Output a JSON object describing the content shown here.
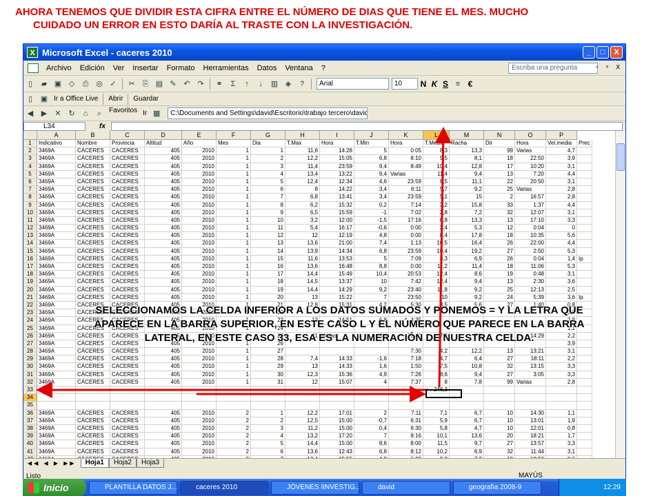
{
  "heading": {
    "line1": "AHORA TENEMOS QUE DIVIDIR ESTA CIFRA ENTRE EL NÚMERO DE DIAS QUE TIENE EL MES. MUCHO",
    "line2": "CUIDADO UN ERROR EN ESTO DARÍA AL TRASTE CON LA INVESTIGACIÓN."
  },
  "window": {
    "title": "Microsoft Excel - caceres 2010",
    "controls": [
      "_",
      "□",
      "X"
    ]
  },
  "menu": {
    "items": [
      "Archivo",
      "Edición",
      "Ver",
      "Insertar",
      "Formato",
      "Herramientas",
      "Datos",
      "Ventana",
      "?"
    ],
    "ask_placeholder": "Escriba una pregunta"
  },
  "toolbar": {
    "font": "Arial",
    "size": "10",
    "bold": "N",
    "italic": "K",
    "underline": "S",
    "currency": "€",
    "live": "Ir a Office Live",
    "open": "Abrir",
    "save": "Guardar",
    "favorites": "Favoritos",
    "go": "Ir",
    "address": "C:\\Documents and Settings\\david\\Escritorio\\trabajo tercero\\david\\"
  },
  "formula": {
    "namebox": "L34",
    "fx": "fx",
    "value": ""
  },
  "grid": {
    "columns": [
      "A",
      "B",
      "C",
      "D",
      "E",
      "F",
      "G",
      "H",
      "I",
      "J",
      "K",
      "L",
      "M",
      "N",
      "O",
      "P"
    ],
    "selected_column": "L",
    "selected_row": "34",
    "rows": [
      [
        "1",
        "Indicativo",
        "Nombre",
        "Provincia",
        "Altitud",
        "Año",
        "Mes",
        "Dia",
        "T.Max",
        "Hora",
        "T.Min",
        "Hora",
        "T.Media",
        "Racha",
        "Dir",
        "Hora",
        "Vel.media",
        "Prec"
      ],
      [
        "2",
        "3469A",
        "CÁCERES",
        "CACERES",
        "405",
        "2010",
        "1",
        "1",
        "11,6",
        "14:28",
        "5",
        "0:05",
        "8,3",
        "13,3",
        "99",
        "Varias",
        "4,7",
        ""
      ],
      [
        "3",
        "3469A",
        "CÁCERES",
        "CACERES",
        "405",
        "2010",
        "1",
        "2",
        "12,2",
        "15:05",
        "6,8",
        "8:10",
        "9,5",
        "8,1",
        "18",
        "22:50",
        "3,9",
        ""
      ],
      [
        "4",
        "3469A",
        "CÁCERES",
        "CACERES",
        "405",
        "2010",
        "1",
        "3",
        "11,4",
        "23:59",
        "9,4",
        "8:49",
        "10,4",
        "12,8",
        "17",
        "10:20",
        "3,1",
        ""
      ],
      [
        "5",
        "3469A",
        "CÁCERES",
        "CACERES",
        "405",
        "2010",
        "1",
        "4",
        "13,4",
        "13:22",
        "9,4",
        "Varias",
        "11,4",
        "9,4",
        "13",
        "7:20",
        "4,4",
        ""
      ],
      [
        "6",
        "3469A",
        "CÁCERES",
        "CACERES",
        "405",
        "2010",
        "1",
        "5",
        "12,4",
        "12:34",
        "4,6",
        "23:59",
        "8,5",
        "11,1",
        "22",
        "20:50",
        "3,1",
        ""
      ],
      [
        "7",
        "3469A",
        "CÁCERES",
        "CACERES",
        "405",
        "2010",
        "1",
        "6",
        "8",
        "14:22",
        "3,4",
        "6:11",
        "5,7",
        "9,2",
        "25",
        "Varias",
        "2,8",
        ""
      ],
      [
        "8",
        "3469A",
        "CÁCERES",
        "CACERES",
        "405",
        "2010",
        "1",
        "7",
        "6,8",
        "13:41",
        "3,4",
        "23:59",
        "5,1",
        "15",
        "2",
        "16:57",
        "2,8",
        ""
      ],
      [
        "9",
        "3469A",
        "CÁCERES",
        "CACERES",
        "405",
        "2010",
        "1",
        "8",
        "6,2",
        "15:32",
        "0,2",
        "7:14",
        "3,2",
        "15,8",
        "33",
        "1:37",
        "4,4",
        ""
      ],
      [
        "10",
        "3469A",
        "CÁCERES",
        "CACERES",
        "405",
        "2010",
        "1",
        "9",
        "6,5",
        "15:59",
        "-1",
        "7:02",
        "2,8",
        "7,2",
        "32",
        "12:07",
        "3,1",
        ""
      ],
      [
        "11",
        "3469A",
        "CÁCERES",
        "CACERES",
        "405",
        "2010",
        "1",
        "10",
        "3,2",
        "12:00",
        "-1,5",
        "17:16",
        "0,8",
        "13,3",
        "13",
        "17:10",
        "3,3",
        ""
      ],
      [
        "12",
        "3469A",
        "CÁCERES",
        "CACERES",
        "405",
        "2010",
        "1",
        "11",
        "5,4",
        "16:17",
        "-0,6",
        "0:00",
        "2,4",
        "5,3",
        "12",
        "0:04",
        "0",
        ""
      ],
      [
        "13",
        "3469A",
        "CÁCERES",
        "CACERES",
        "405",
        "2010",
        "1",
        "12",
        "12",
        "12:19",
        "4,8",
        "0:00",
        "8,4",
        "17,8",
        "18",
        "10:35",
        "5,6",
        ""
      ],
      [
        "14",
        "3469A",
        "CÁCERES",
        "CACERES",
        "405",
        "2010",
        "1",
        "13",
        "13,6",
        "21:00",
        "7,4",
        "1:13",
        "10,5",
        "16,4",
        "26",
        "22:00",
        "4,4",
        ""
      ],
      [
        "15",
        "3469A",
        "CÁCERES",
        "CACERES",
        "405",
        "2010",
        "1",
        "14",
        "13,9",
        "14:34",
        "6,8",
        "23:59",
        "10,4",
        "19,2",
        "27",
        "2:50",
        "5,3",
        ""
      ],
      [
        "16",
        "3469A",
        "CÁCERES",
        "CACERES",
        "405",
        "2010",
        "1",
        "15",
        "11,6",
        "13:53",
        "5",
        "7:09",
        "8,3",
        "6,9",
        "26",
        "0:04",
        "1,4",
        "Ip"
      ],
      [
        "17",
        "3469A",
        "CÁCERES",
        "CACERES",
        "405",
        "2010",
        "1",
        "16",
        "13,6",
        "16:48",
        "8,8",
        "0:00",
        "11,2",
        "11,4",
        "18",
        "11:06",
        "5,3",
        ""
      ],
      [
        "18",
        "3469A",
        "CÁCERES",
        "CACERES",
        "405",
        "2010",
        "1",
        "17",
        "14,4",
        "15:49",
        "10,4",
        "20:53",
        "12,4",
        "8,6",
        "19",
        "0:48",
        "3,1",
        ""
      ],
      [
        "19",
        "3469A",
        "CÁCERES",
        "CACERES",
        "405",
        "2010",
        "1",
        "18",
        "14,5",
        "13:37",
        "10",
        "7:42",
        "12,4",
        "9,4",
        "13",
        "2:30",
        "3,6",
        ""
      ],
      [
        "20",
        "3469A",
        "CÁCERES",
        "CACERES",
        "405",
        "2010",
        "1",
        "19",
        "14,4",
        "14:29",
        "9,2",
        "23:40",
        "11,8",
        "9,2",
        "25",
        "12:13",
        "2,5",
        ""
      ],
      [
        "21",
        "3469A",
        "CÁCERES",
        "CACERES",
        "405",
        "2010",
        "1",
        "20",
        "13",
        "15:22",
        "7",
        "23:50",
        "10",
        "9,2",
        "24",
        "5:39",
        "3,6",
        "Ip"
      ],
      [
        "22",
        "3469A",
        "CÁCERES",
        "CACERES",
        "405",
        "2010",
        "1",
        "21",
        "12,8",
        "15:31",
        "4,2",
        "5:30",
        "8,5",
        "5,6",
        "27",
        "1:40",
        "0,8",
        ""
      ],
      [
        "23",
        "3469A",
        "CÁCERES",
        "CACERES",
        "405",
        "2010",
        "1",
        "22",
        "",
        "",
        "",
        "",
        "",
        "",
        "",
        "",
        "0,8",
        ""
      ],
      [
        "24",
        "3469A",
        "CÁCERES",
        "CACERES",
        "405",
        "2010",
        "1",
        "23",
        "13",
        "14:51",
        "6,8",
        "4:35",
        "",
        "",
        "",
        "",
        "2,8",
        ""
      ],
      [
        "25",
        "3469A",
        "CÁCERES",
        "CACERES",
        "405",
        "2010",
        "1",
        "24",
        "",
        "",
        "",
        "",
        "",
        "",
        "",
        "",
        "1,1",
        ""
      ],
      [
        "26",
        "3469A",
        "CÁCERES",
        "CACERES",
        "405",
        "2010",
        "1",
        "25",
        "11",
        "Varias",
        "3,6",
        "23:40",
        "7,3",
        "7,5",
        "3",
        "14:29",
        "2,2",
        ""
      ],
      [
        "27",
        "3469A",
        "CÁCERES",
        "CACERES",
        "405",
        "2010",
        "1",
        "26",
        "",
        "",
        "",
        "",
        "",
        "",
        "",
        "",
        "3,9",
        ""
      ],
      [
        "28",
        "3469A",
        "CÁCERES",
        "CACERES",
        "405",
        "2010",
        "1",
        "27",
        "",
        "",
        "",
        "7:30",
        "4,2",
        "12,2",
        "13",
        "13:21",
        "3,1",
        ""
      ],
      [
        "29",
        "3469A",
        "CÁCERES",
        "CACERES",
        "405",
        "2010",
        "1",
        "28",
        "7,4",
        "14:33",
        "-1,6",
        "7:18",
        "4,7",
        "6,4",
        "27",
        "18:11",
        "2,2",
        ""
      ],
      [
        "30",
        "3469A",
        "CÁCERES",
        "CACERES",
        "405",
        "2010",
        "1",
        "29",
        "13",
        "14:33",
        "1,6",
        "1:50",
        "7,5",
        "10,8",
        "32",
        "13:15",
        "3,3",
        ""
      ],
      [
        "31",
        "3469A",
        "CÁCERES",
        "CACERES",
        "405",
        "2010",
        "1",
        "30",
        "12,3",
        "15:36",
        "4,9",
        "7:26",
        "8,6",
        "9,4",
        "27",
        "3:05",
        "3,3",
        ""
      ],
      [
        "32",
        "3469A",
        "CÁCERES",
        "CACERES",
        "405",
        "2010",
        "1",
        "31",
        "12",
        "15:07",
        "4",
        "7:37",
        "8",
        "7,8",
        "99",
        "Varias",
        "2,8",
        ""
      ],
      [
        "33",
        "",
        "",
        "",
        "",
        "",
        "",
        "",
        "",
        "",
        "",
        "",
        "246,3",
        "",
        "",
        "",
        "",
        ""
      ],
      [
        "34",
        "",
        "",
        "",
        "",
        "",
        "",
        "",
        "",
        "",
        "",
        "",
        "",
        "",
        "",
        "",
        "",
        ""
      ],
      [
        "35",
        "",
        "",
        "",
        "",
        "",
        "",
        "",
        "",
        "",
        "",
        "",
        "",
        "",
        "",
        "",
        "",
        ""
      ],
      [
        "36",
        "3469A",
        "CÁCERES",
        "CACERES",
        "405",
        "2010",
        "2",
        "1",
        "12,2",
        "17:01",
        "2",
        "7:11",
        "7,1",
        "6,7",
        "10",
        "14:30",
        "1,1",
        ""
      ],
      [
        "37",
        "3469A",
        "CÁCERES",
        "CACERES",
        "405",
        "2010",
        "2",
        "2",
        "12,5",
        "15:00",
        "-0,7",
        "6:31",
        "5,9",
        "6,7",
        "10",
        "13:01",
        "1,9",
        ""
      ],
      [
        "38",
        "3469A",
        "CÁCERES",
        "CACERES",
        "405",
        "2010",
        "2",
        "3",
        "11,2",
        "15:00",
        "0,4",
        "6:30",
        "5,8",
        "4,7",
        "10",
        "12:01",
        "0,8",
        ""
      ],
      [
        "39",
        "3469A",
        "CÁCERES",
        "CACERES",
        "405",
        "2010",
        "2",
        "4",
        "13,2",
        "17:20",
        "7",
        "8:16",
        "10,1",
        "13,6",
        "20",
        "18:21",
        "1,7",
        ""
      ],
      [
        "40",
        "3469A",
        "CÁCERES",
        "CACERES",
        "405",
        "2010",
        "2",
        "5",
        "14,4",
        "15:00",
        "8,6",
        "8:00",
        "11,5",
        "9,7",
        "27",
        "13:57",
        "3,3",
        ""
      ],
      [
        "41",
        "3469A",
        "CÁCERES",
        "CACERES",
        "405",
        "2010",
        "2",
        "6",
        "13,6",
        "12:43",
        "6,8",
        "8:12",
        "10,2",
        "6,9",
        "32",
        "11:44",
        "3,1",
        ""
      ],
      [
        "42",
        "3469A",
        "CÁCERES",
        "CACERES",
        "405",
        "2010",
        "2",
        "7",
        "13,4",
        "15:55",
        "4,9",
        "6:30",
        "9,2",
        "7,2",
        "18",
        "18:50",
        "0,6",
        ""
      ]
    ]
  },
  "sheets": {
    "tabs": [
      "Hoja1",
      "Hoja2",
      "Hoja3"
    ],
    "active": "Hoja1"
  },
  "status": {
    "left": "Listo",
    "caps": "MAYÚS"
  },
  "taskbar": {
    "start": "Inicio",
    "tasks": [
      "PLANTILLA DATOS J...",
      "caceres 2010",
      "JÓVENES IINVESTIG...",
      "david",
      "geografía 2008-9"
    ],
    "clock": "12:29"
  },
  "callout": "SELECCIONAMOS LA CELDA INFERIOR A LOS DATOS SUMADOS Y PONEMOS = Y LA LETRA QUE APARECE EN LA BARRA SUPERIOR, EN ESTE CASO L Y EL NÚMERO QUE PARECE EN LA BARRA LATERAL, EN ESTE CASO 33, ESA ES LA NUMERACIÓN DE NUESTRA CELDA.",
  "colors": {
    "heading": "#e00000",
    "arrow": "#e00000",
    "selection": "#f7c550"
  }
}
